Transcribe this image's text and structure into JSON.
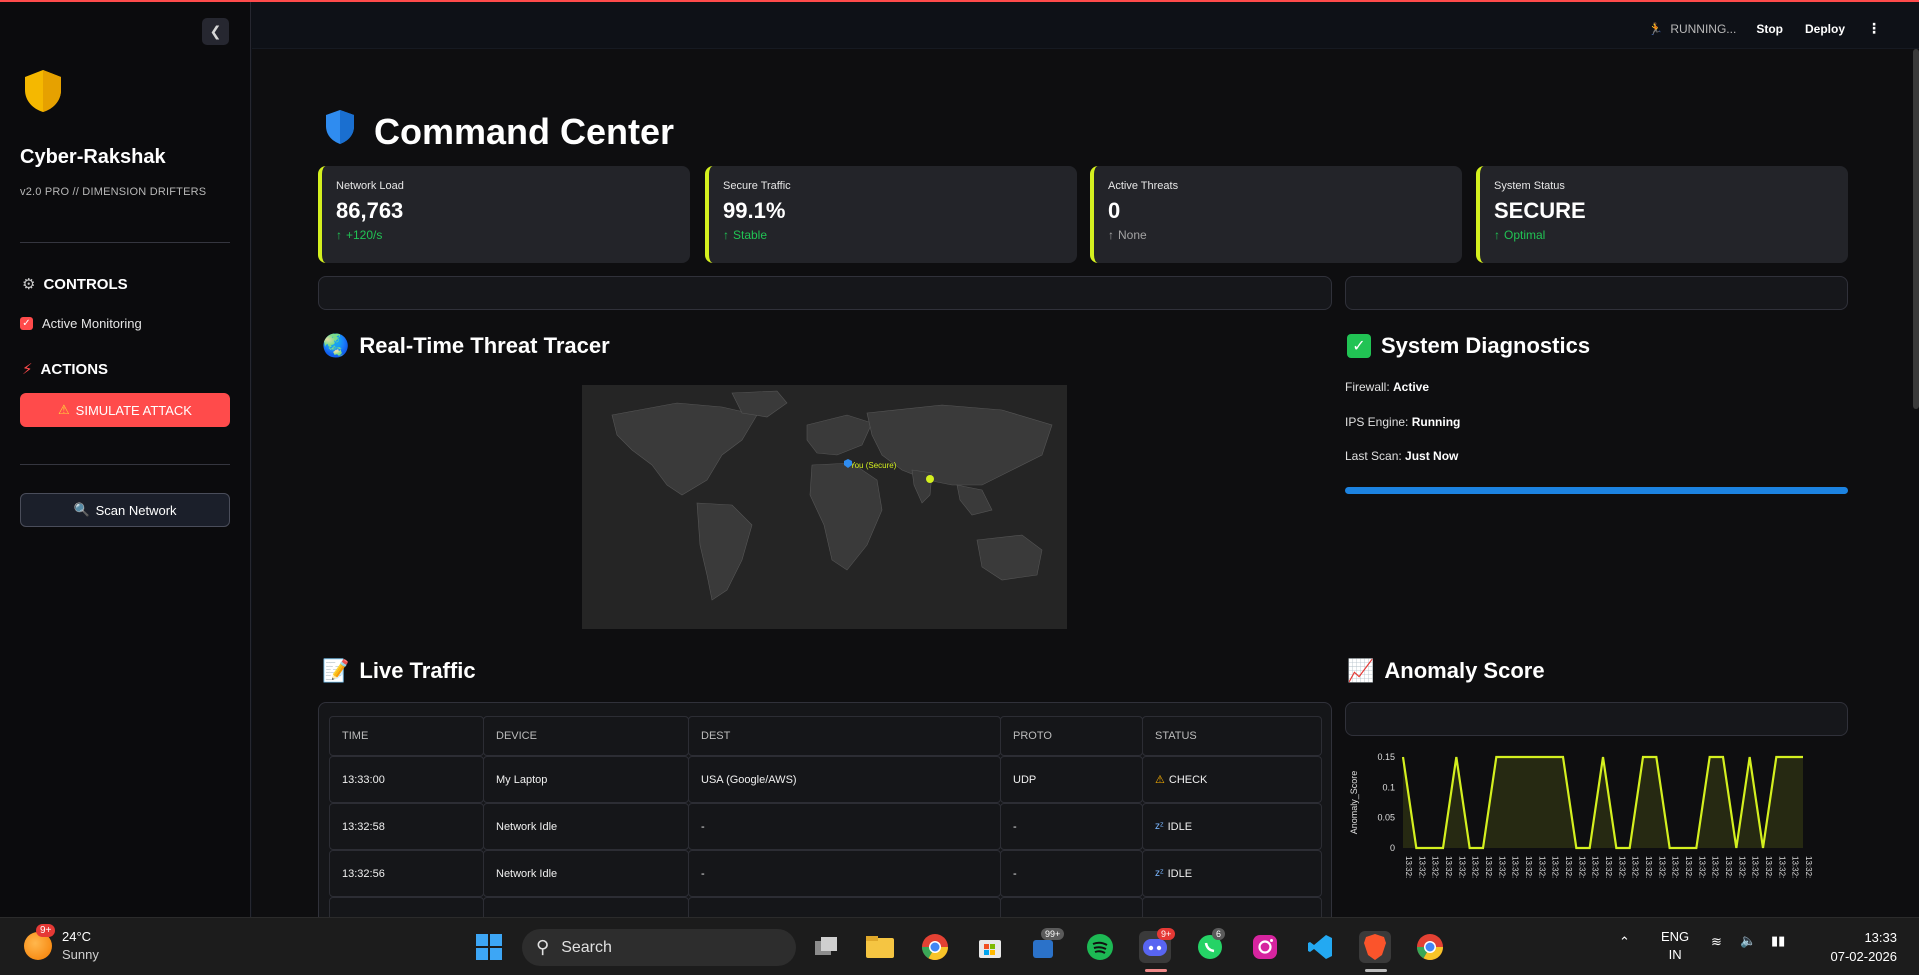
{
  "sidebar": {
    "brand": "Cyber-Rakshak",
    "version": "v2.0 PRO // DIMENSION DRIFTERS",
    "controls_heading": "CONTROLS",
    "monitoring_label": "Active Monitoring",
    "actions_heading": "ACTIONS",
    "attack_button": "SIMULATE ATTACK",
    "scan_button": "Scan Network"
  },
  "header": {
    "status": "RUNNING...",
    "stop": "Stop",
    "deploy": "Deploy"
  },
  "main": {
    "title": "Command Center",
    "metrics": [
      {
        "label": "Network Load",
        "value": "86,763",
        "delta": "+120/s",
        "tone": "green"
      },
      {
        "label": "Secure Traffic",
        "value": "99.1%",
        "delta": "Stable",
        "tone": "green"
      },
      {
        "label": "Active Threats",
        "value": "0",
        "delta": "None",
        "tone": "gray"
      },
      {
        "label": "System Status",
        "value": "SECURE",
        "delta": "Optimal",
        "tone": "green"
      }
    ],
    "tracer_heading": "Real-Time Threat Tracer",
    "map_marker": "You (Secure)",
    "diagnostics_heading": "System Diagnostics",
    "diagnostics": [
      {
        "key": "Firewall:",
        "value": "Active"
      },
      {
        "key": "IPS Engine:",
        "value": "Running"
      },
      {
        "key": "Last Scan:",
        "value": "Just Now"
      }
    ],
    "diagnostics_progress": 1.0,
    "traffic_heading": "Live Traffic",
    "traffic_columns": [
      "TIME",
      "DEVICE",
      "DEST",
      "PROTO",
      "STATUS"
    ],
    "traffic_rows": [
      {
        "time": "13:33:00",
        "device": "My Laptop",
        "dest": "USA (Google/AWS)",
        "proto": "UDP",
        "status": "CHECK"
      },
      {
        "time": "13:32:58",
        "device": "Network Idle",
        "dest": "-",
        "proto": "-",
        "status": "IDLE"
      },
      {
        "time": "13:32:56",
        "device": "Network Idle",
        "dest": "-",
        "proto": "-",
        "status": "IDLE"
      }
    ],
    "anomaly_heading": "Anomaly Score"
  },
  "chart_data": {
    "type": "area",
    "title": "",
    "xlabel": "",
    "ylabel": "Anomaly_Score",
    "ylim": [
      0,
      0.15
    ],
    "yticks": [
      "0.15",
      "0.1",
      "0.05",
      "0"
    ],
    "x_tick_label": "13:32:",
    "series": [
      {
        "color": "#d4f01f",
        "values": [
          0.15,
          0,
          0,
          0,
          0.15,
          0,
          0,
          0.15,
          0.15,
          0.15,
          0.15,
          0.15,
          0.15,
          0,
          0,
          0.15,
          0,
          0,
          0.15,
          0.15,
          0,
          0,
          0,
          0.15,
          0.15,
          0,
          0.15,
          0,
          0.15,
          0.15,
          0.15
        ]
      }
    ]
  },
  "taskbar": {
    "temperature": "24°C",
    "condition": "Sunny",
    "weather_badge": "9+",
    "search_placeholder": "Search",
    "teams_badge": "99+",
    "discord_badge": "9+",
    "whatsapp_badge": "6",
    "lang1": "ENG",
    "lang2": "IN",
    "time": "13:33",
    "date": "07-02-2026"
  },
  "colors": {
    "accent": "#d4f01f",
    "danger": "#ff4b4b",
    "success": "#21c354",
    "progress": "#1c83e1"
  }
}
